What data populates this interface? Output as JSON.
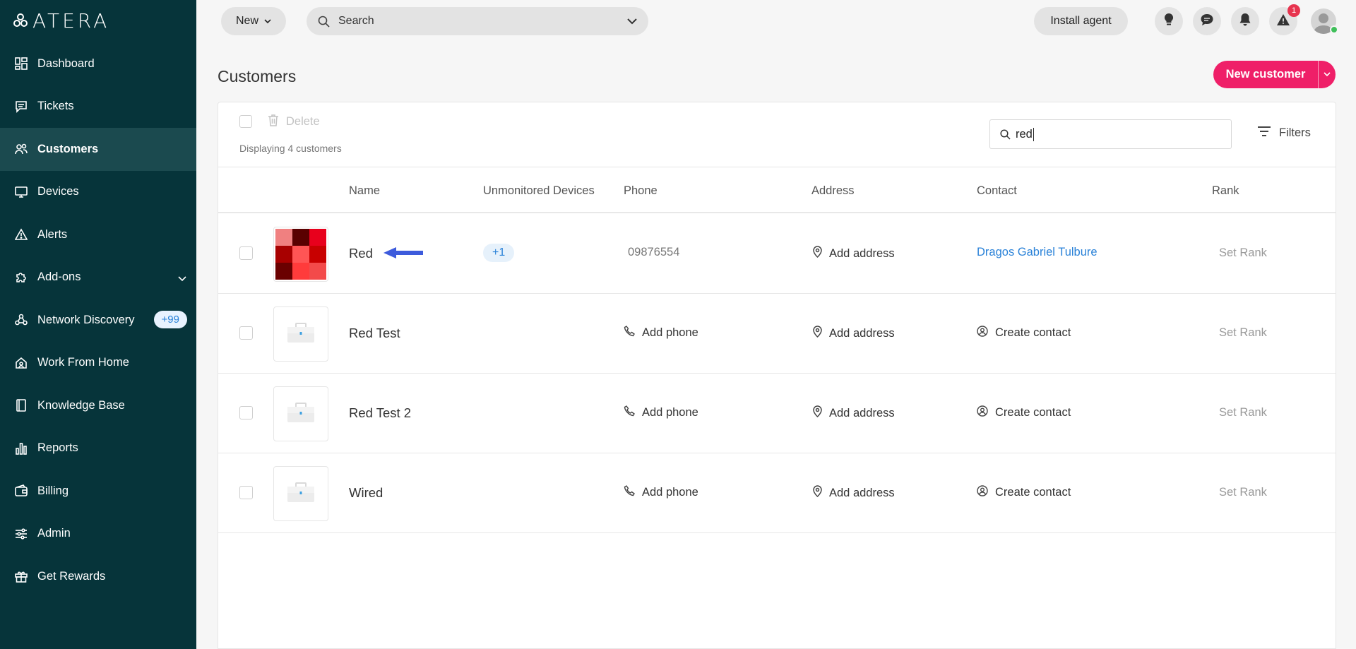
{
  "app": {
    "logo": "ATERA"
  },
  "sidebar": {
    "items": [
      {
        "label": "Dashboard",
        "icon": "dashboard-icon"
      },
      {
        "label": "Tickets",
        "icon": "tickets-icon"
      },
      {
        "label": "Customers",
        "icon": "customers-icon",
        "active": true
      },
      {
        "label": "Devices",
        "icon": "devices-icon"
      },
      {
        "label": "Alerts",
        "icon": "alerts-icon"
      },
      {
        "label": "Add-ons",
        "icon": "addons-icon"
      },
      {
        "label": "Network Discovery",
        "icon": "network-discovery-icon",
        "badge": "+99"
      },
      {
        "label": "Work From Home",
        "icon": "work-from-home-icon"
      },
      {
        "label": "Knowledge Base",
        "icon": "knowledge-base-icon"
      },
      {
        "label": "Reports",
        "icon": "reports-icon"
      },
      {
        "label": "Billing",
        "icon": "billing-icon"
      },
      {
        "label": "Admin",
        "icon": "admin-icon"
      },
      {
        "label": "Get Rewards",
        "icon": "rewards-icon"
      }
    ]
  },
  "topbar": {
    "new_label": "New",
    "search_label": "Search",
    "install_label": "Install agent",
    "alerts_count": "1"
  },
  "page": {
    "title": "Customers",
    "new_customer_label": "New customer"
  },
  "toolbar": {
    "delete_label": "Delete",
    "display_count": "Displaying 4 customers",
    "filter_value": "red",
    "filters_label": "Filters"
  },
  "table": {
    "columns": [
      "Name",
      "Unmonitored Devices",
      "Phone",
      "Address",
      "Contact",
      "Rank"
    ],
    "rows": [
      {
        "name": "Red",
        "unmonitored": "+1",
        "phone": "09876554",
        "address": "Add address",
        "contact": "Dragos Gabriel Tulbure",
        "rank": "Set Rank"
      },
      {
        "name": "Red Test",
        "unmonitored": "",
        "phone": "Add phone",
        "address": "Add address",
        "contact": "Create contact",
        "rank": "Set Rank"
      },
      {
        "name": "Red Test 2",
        "unmonitored": "",
        "phone": "Add phone",
        "address": "Add address",
        "contact": "Create contact",
        "rank": "Set Rank"
      },
      {
        "name": "Wired",
        "unmonitored": "",
        "phone": "Add phone",
        "address": "Add address",
        "contact": "Create contact",
        "rank": "Set Rank"
      }
    ]
  },
  "colors": {
    "sidebar_bg": "#06343a",
    "accent": "#ef1f68",
    "link": "#2a82d8",
    "mosaic": [
      "#f08080",
      "#5a0000",
      "#e8001c",
      "#a80000",
      "#ff5555",
      "#c80000",
      "#6a0000",
      "#ff3b3b",
      "#f34a4a"
    ]
  }
}
